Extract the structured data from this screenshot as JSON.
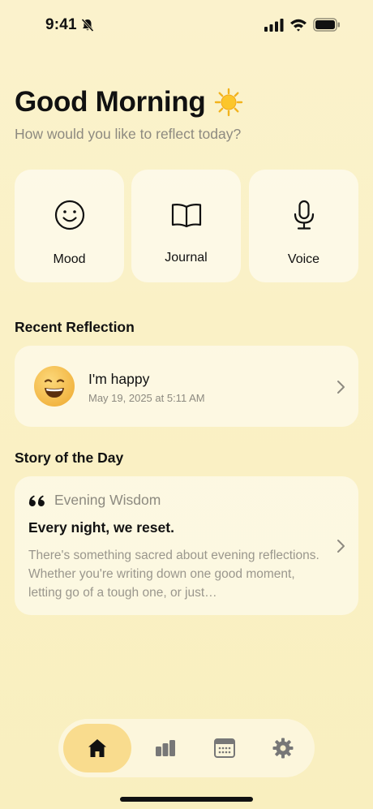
{
  "status": {
    "time": "9:41"
  },
  "header": {
    "greeting": "Good Morning",
    "subtitle": "How would you like to reflect today?"
  },
  "actions": [
    {
      "label": "Mood",
      "icon": "smile-icon"
    },
    {
      "label": "Journal",
      "icon": "book-icon"
    },
    {
      "label": "Voice",
      "icon": "microphone-icon"
    }
  ],
  "recent": {
    "section_title": "Recent Reflection",
    "title": "I'm happy",
    "date": "May 19, 2025 at 5:11 AM"
  },
  "story": {
    "section_title": "Story of the Day",
    "eyebrow": "Evening Wisdom",
    "heading": "Every night, we reset.",
    "body": "There's something sacred about evening reflections. Whether you're writing down one good moment, letting go of a tough one, or just…"
  },
  "tabs": [
    {
      "icon": "home-icon",
      "active": true
    },
    {
      "icon": "bar-chart-icon",
      "active": false
    },
    {
      "icon": "calendar-icon",
      "active": false
    },
    {
      "icon": "gear-icon",
      "active": false
    }
  ],
  "colors": {
    "background": "#faf1c6",
    "active_tab": "#f9dc8e",
    "muted_text": "#8d8a80"
  }
}
